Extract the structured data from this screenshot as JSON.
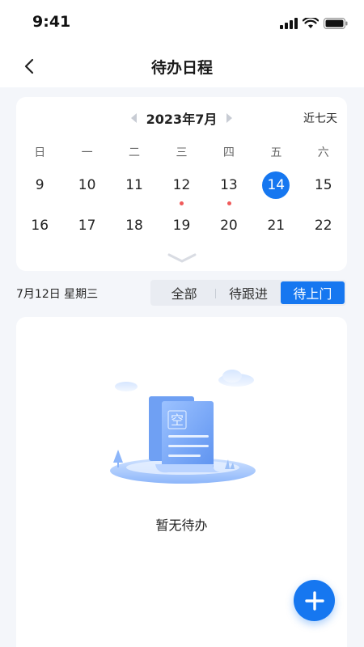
{
  "status": {
    "time": "9:41"
  },
  "nav": {
    "title": "待办日程"
  },
  "calendar": {
    "month_label": "2023年7月",
    "recent_label": "近七天",
    "weekdays": [
      "日",
      "一",
      "二",
      "三",
      "四",
      "五",
      "六"
    ],
    "row1": [
      "9",
      "10",
      "11",
      "12",
      "13",
      "14",
      "15"
    ],
    "row2": [
      "16",
      "17",
      "18",
      "19",
      "20",
      "21",
      "22"
    ],
    "selected_day": "14",
    "days_with_events": [
      "12",
      "13"
    ]
  },
  "filter": {
    "date_caption": "7月12日 星期三",
    "tabs": [
      "全部",
      "待跟进",
      "待上门"
    ],
    "active_tab": "待上门"
  },
  "empty_state": {
    "illustration_text": "空",
    "message": "暂无待办"
  },
  "colors": {
    "accent": "#1677F0",
    "event_dot": "#F05A5A",
    "page_bg": "#F4F6FA"
  }
}
